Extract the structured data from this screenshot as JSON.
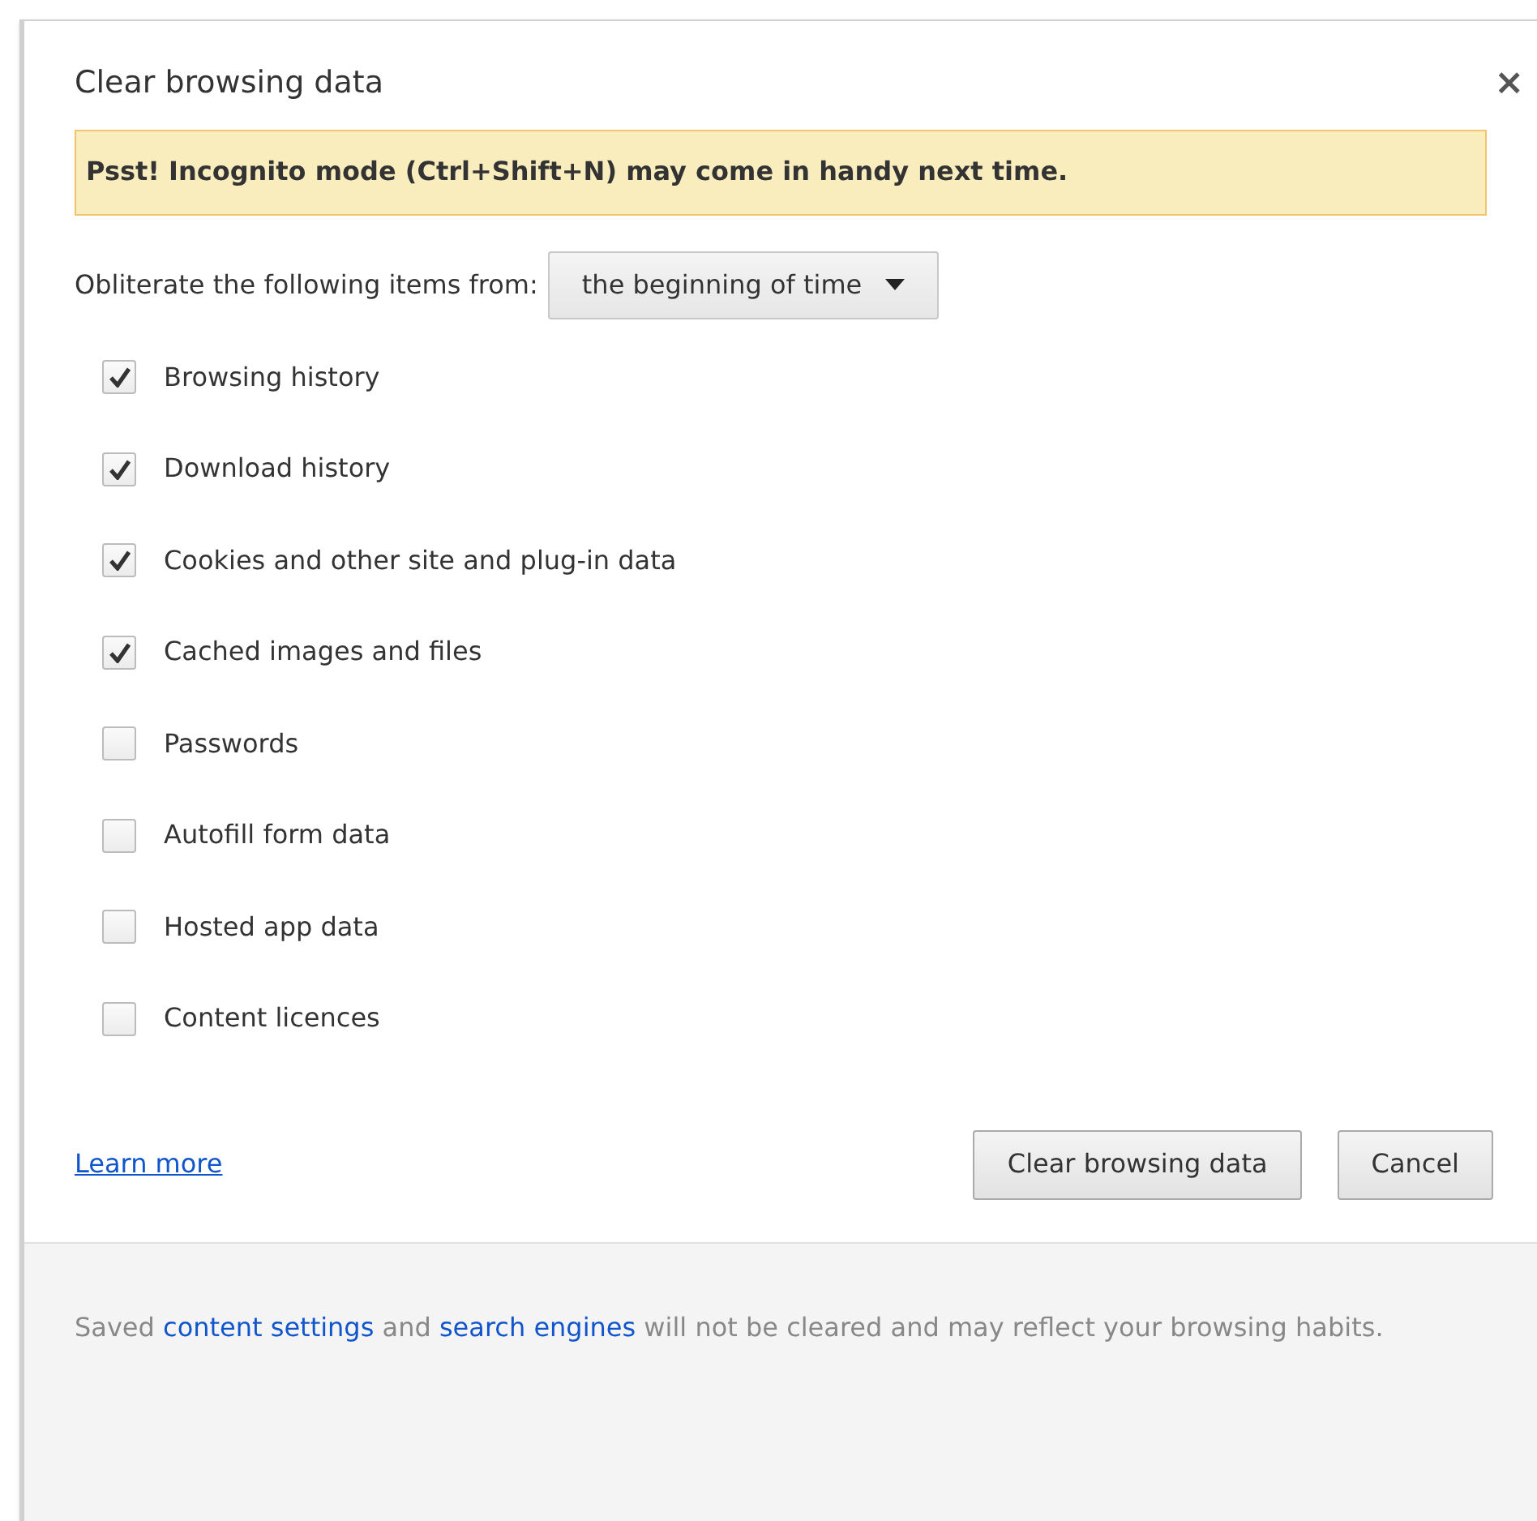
{
  "dialog": {
    "title": "Clear browsing data",
    "close": "×"
  },
  "banner": "Psst! Incognito mode (Ctrl+Shift+N) may come in handy next time.",
  "range": {
    "label": "Obliterate the following items from:",
    "value": "the beginning of time"
  },
  "items": [
    {
      "label": "Browsing history",
      "checked": true
    },
    {
      "label": "Download history",
      "checked": true
    },
    {
      "label": "Cookies and other site and plug-in data",
      "checked": true
    },
    {
      "label": "Cached images and files",
      "checked": true
    },
    {
      "label": "Passwords",
      "checked": false
    },
    {
      "label": "Autofill form data",
      "checked": false
    },
    {
      "label": "Hosted app data",
      "checked": false
    },
    {
      "label": "Content licences",
      "checked": false
    }
  ],
  "learn_more": "Learn more",
  "buttons": [
    "Clear browsing data",
    "Cancel"
  ],
  "footer": [
    {
      "kind": "text",
      "text": "Saved "
    },
    {
      "kind": "link",
      "text": "content settings"
    },
    {
      "kind": "text",
      "text": " and "
    },
    {
      "kind": "link",
      "text": "search engines"
    },
    {
      "kind": "text",
      "text": " will not be cleared and may reflect your browsing habits."
    }
  ]
}
